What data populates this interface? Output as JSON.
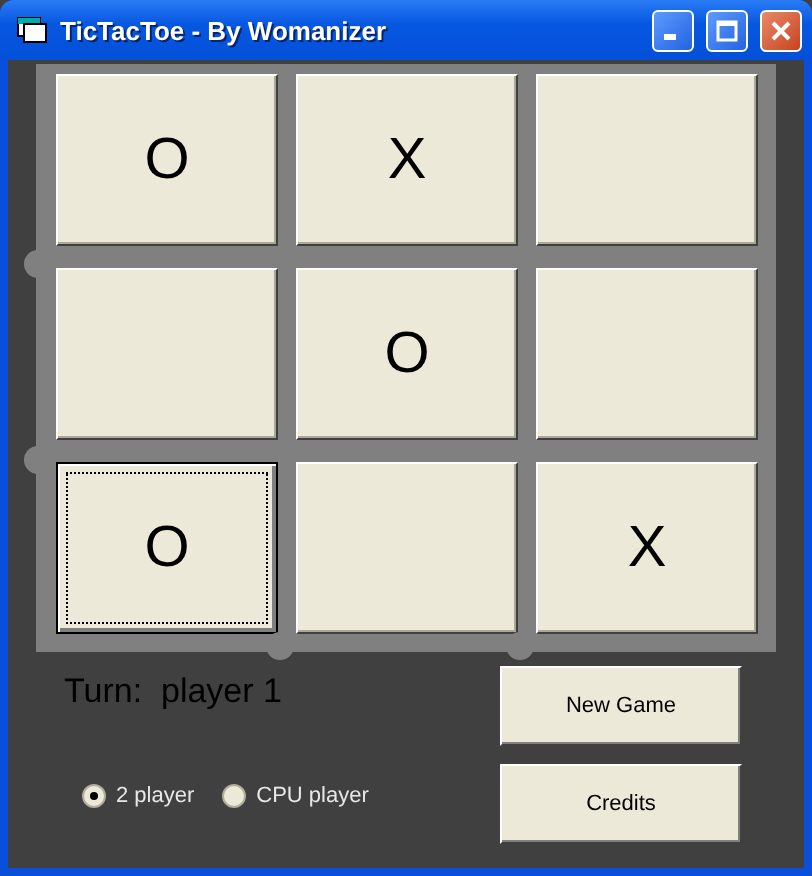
{
  "window": {
    "title": "TicTacToe - By Womanizer"
  },
  "board": {
    "cells": [
      {
        "mark": "O",
        "focused": false
      },
      {
        "mark": "X",
        "focused": false
      },
      {
        "focused": false
      },
      {
        "focused": false
      },
      {
        "mark": "O",
        "focused": false
      },
      {
        "focused": false
      },
      {
        "mark": "O",
        "focused": true
      },
      {
        "focused": false
      },
      {
        "mark": "X",
        "focused": false
      }
    ]
  },
  "turn_label": "Turn:  player 1",
  "modes": [
    {
      "label": "2 player",
      "selected": true
    },
    {
      "label": "CPU player",
      "selected": false
    }
  ],
  "buttons": [
    "New Game",
    "Credits"
  ]
}
